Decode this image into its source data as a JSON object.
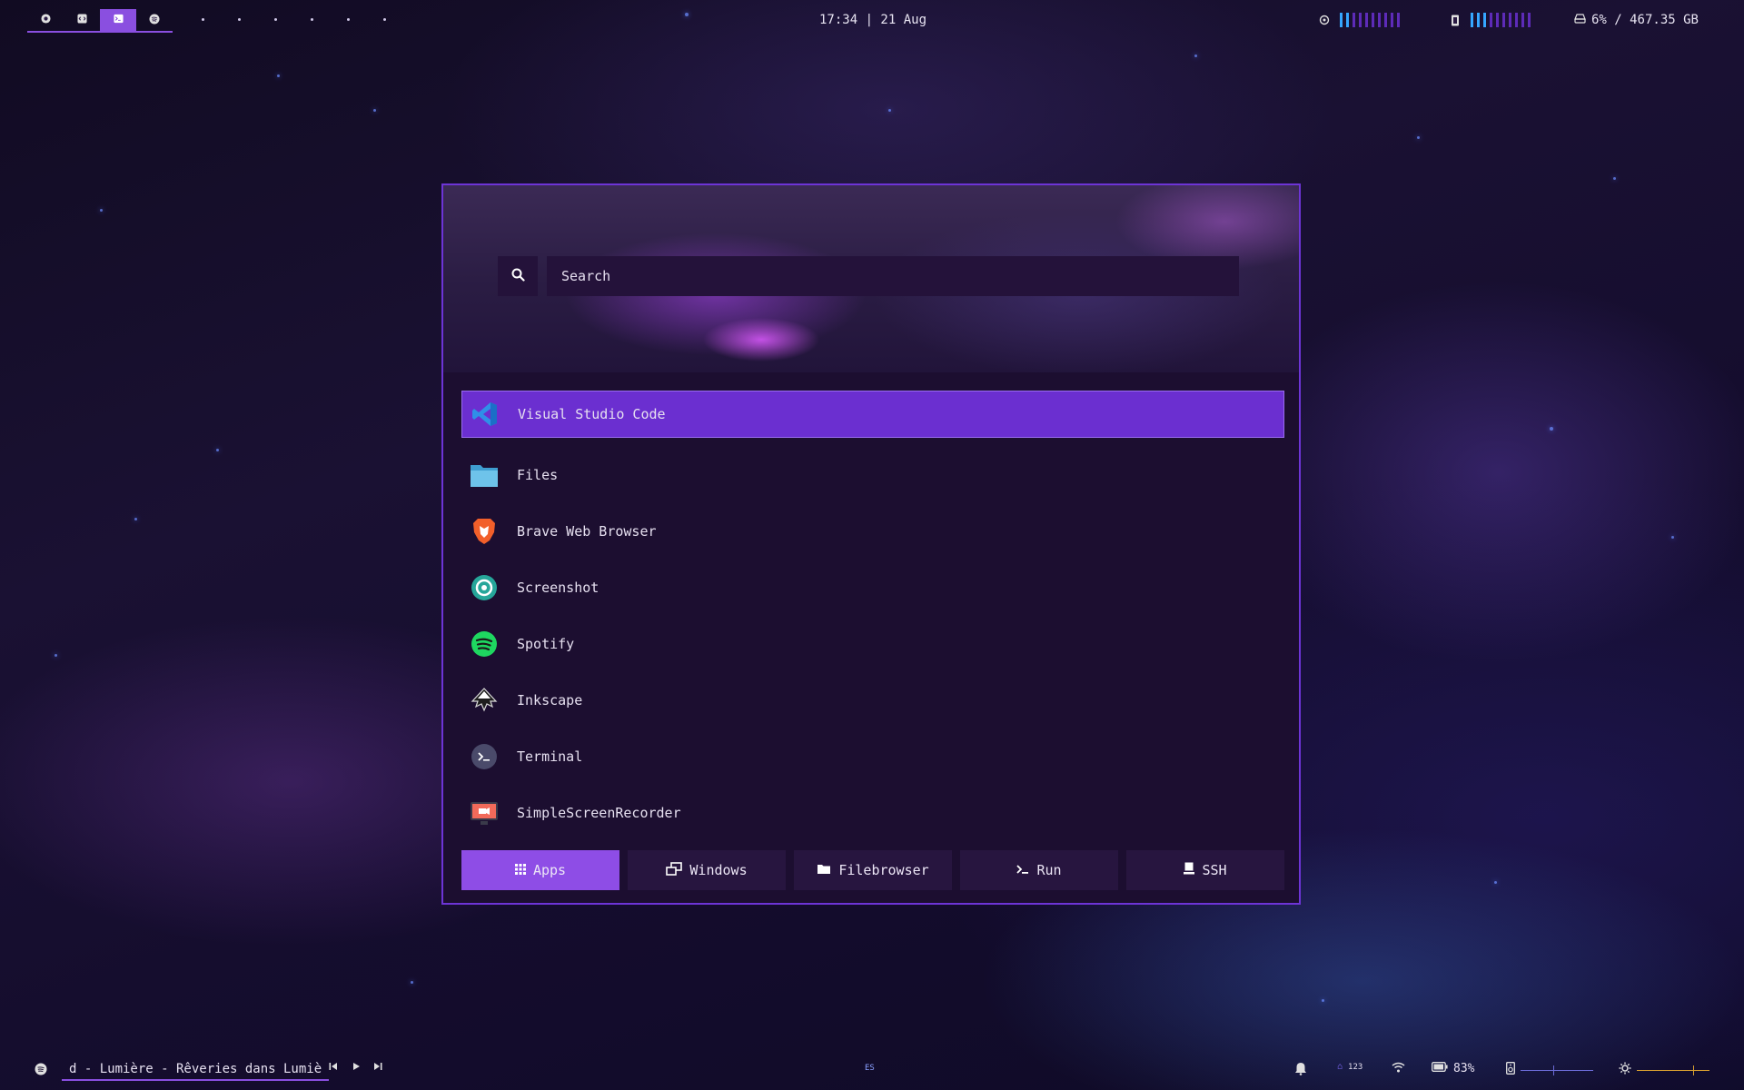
{
  "topbar": {
    "workspaces": [
      {
        "icon": "chrome-icon",
        "active": false
      },
      {
        "icon": "code-icon",
        "active": false
      },
      {
        "icon": "terminal-icon",
        "active": true
      },
      {
        "icon": "spotify-icon",
        "active": false
      }
    ],
    "clock": "17:34 | 21 Aug",
    "cpu_level": 0.15,
    "memory_level": 0.25,
    "disk": "6% / 467.35 GB"
  },
  "launcher": {
    "search": {
      "placeholder": "Search",
      "value": ""
    },
    "items": [
      {
        "label": "Visual Studio Code",
        "icon": "vscode-icon",
        "selected": true
      },
      {
        "label": "Files",
        "icon": "folder-icon",
        "selected": false
      },
      {
        "label": "Brave Web Browser",
        "icon": "brave-icon",
        "selected": false
      },
      {
        "label": "Screenshot",
        "icon": "screenshot-icon",
        "selected": false
      },
      {
        "label": "Spotify",
        "icon": "spotify-icon",
        "selected": false
      },
      {
        "label": "Inkscape",
        "icon": "inkscape-icon",
        "selected": false
      },
      {
        "label": "Terminal",
        "icon": "terminal-icon",
        "selected": false
      },
      {
        "label": "SimpleScreenRecorder",
        "icon": "recorder-icon",
        "selected": false
      }
    ],
    "modes": [
      {
        "label": "Apps",
        "icon": "grid-icon",
        "active": true
      },
      {
        "label": "Windows",
        "icon": "windows-icon",
        "active": false
      },
      {
        "label": "Filebrowser",
        "icon": "folder-icon",
        "active": false
      },
      {
        "label": "Run",
        "icon": "prompt-icon",
        "active": false
      },
      {
        "label": "SSH",
        "icon": "computer-icon",
        "active": false
      }
    ],
    "colors": {
      "accent": "#8e4de6",
      "selected": "#6b2fd0",
      "panel": "#1c0e30",
      "border": "#6d34d6"
    }
  },
  "bottombar": {
    "now_playing": "d - Lumière - Rêveries dans Lumiè",
    "keyboard_layout": "ES",
    "numlock": "123",
    "battery": "83%",
    "volume_level": 0.45,
    "brightness_level": 0.78
  }
}
